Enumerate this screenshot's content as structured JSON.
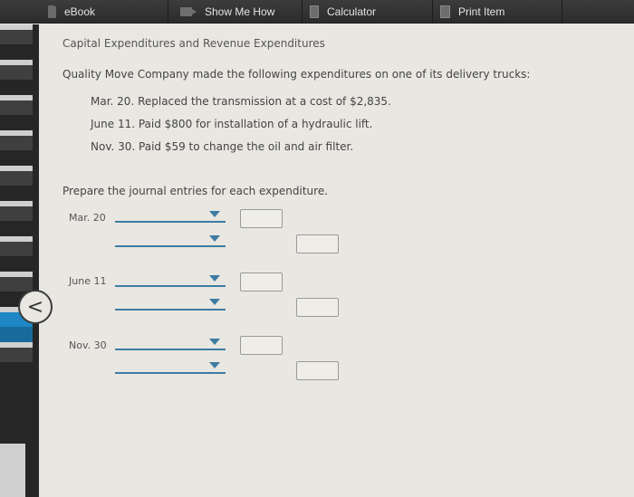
{
  "toolbar": {
    "items": [
      {
        "label": "eBook",
        "icon": "book-icon"
      },
      {
        "label": "Show Me How",
        "icon": "video-icon"
      },
      {
        "label": "Calculator",
        "icon": "calculator-icon"
      },
      {
        "label": "Print Item",
        "icon": "print-icon"
      }
    ]
  },
  "problem": {
    "title": "Capital Expenditures and Revenue Expenditures",
    "intro": "Quality Move Company made the following expenditures on one of its delivery trucks:",
    "items": [
      "Mar. 20. Replaced the transmission at a cost of $2,835.",
      "June 11. Paid $800 for installation of a hydraulic lift.",
      "Nov. 30. Paid $59 to change the oil and air filter."
    ],
    "instruction": "Prepare the journal entries for each expenditure."
  },
  "journal": {
    "entries": [
      {
        "date": "Mar. 20",
        "debit_account": "",
        "debit_amount": "",
        "credit_account": "",
        "credit_amount": ""
      },
      {
        "date": "June 11",
        "debit_account": "",
        "debit_amount": "",
        "credit_account": "",
        "credit_amount": ""
      },
      {
        "date": "Nov. 30",
        "debit_account": "",
        "debit_amount": "",
        "credit_account": "",
        "credit_amount": ""
      }
    ]
  },
  "nav": {
    "collapse_icon": "chevron-left-icon",
    "collapse_glyph": "<"
  }
}
